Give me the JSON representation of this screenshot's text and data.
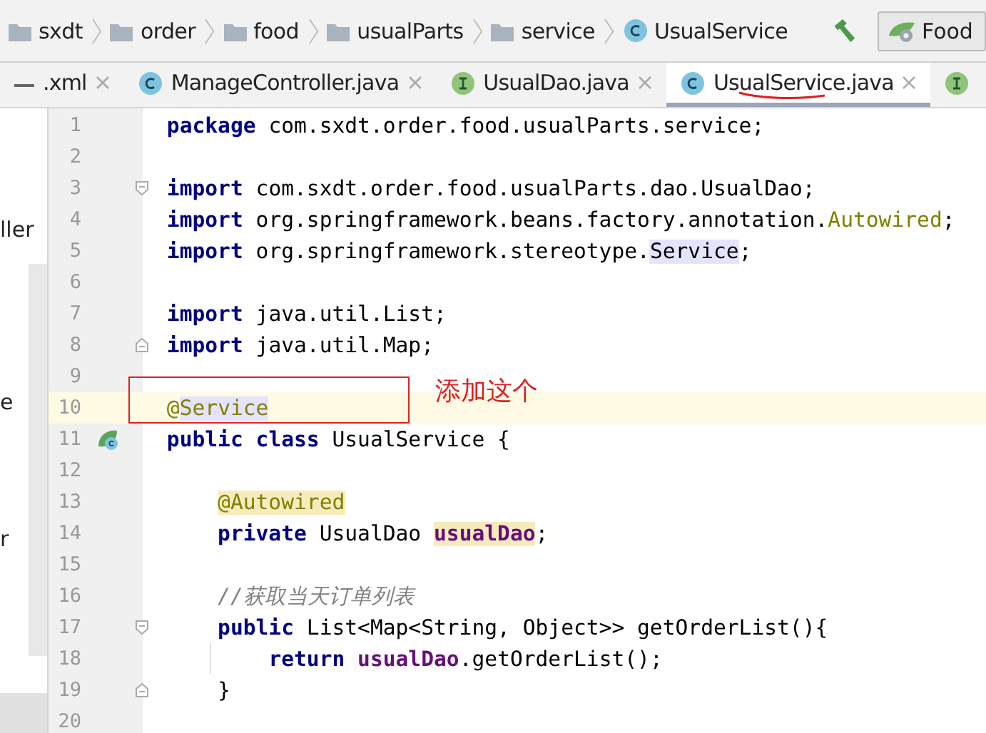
{
  "breadcrumbs": [
    {
      "label": "sxdt",
      "kind": "folder"
    },
    {
      "label": "order",
      "kind": "folder"
    },
    {
      "label": "food",
      "kind": "folder"
    },
    {
      "label": "usualParts",
      "kind": "folder"
    },
    {
      "label": "service",
      "kind": "folder"
    },
    {
      "label": "UsualService",
      "kind": "class"
    }
  ],
  "run_config": {
    "label": "Food"
  },
  "tabs": [
    {
      "label": ".xml",
      "closable": true,
      "selected": false
    },
    {
      "label": "ManageController.java",
      "kind": "class",
      "closable": true,
      "selected": false
    },
    {
      "label": "UsualDao.java",
      "kind": "interface",
      "closable": true,
      "selected": false
    },
    {
      "label": "UsualService.java",
      "kind": "class",
      "closable": true,
      "selected": true
    },
    {
      "kind": "interface",
      "closable": false,
      "selected": false
    }
  ],
  "side_panel": {
    "fragments": [
      "ller",
      "e",
      "r"
    ]
  },
  "editor": {
    "lines": [
      {
        "number": "1",
        "kind": "plain",
        "current": false,
        "tokens": [
          {
            "text": "package",
            "kind": "keyword"
          },
          {
            "text": " com.sxdt.order.food.usualParts.service;",
            "kind": "plain"
          }
        ]
      },
      {
        "number": "2",
        "kind": "plain",
        "current": false
      },
      {
        "number": "3",
        "kind": "fold-start",
        "current": false,
        "tokens": [
          {
            "text": "import",
            "kind": "keyword"
          },
          {
            "text": " com.sxdt.order.food.usualParts.dao.UsualDao;",
            "kind": "plain"
          }
        ]
      },
      {
        "number": "4",
        "kind": "plain",
        "current": false,
        "tokens": [
          {
            "text": "import",
            "kind": "keyword"
          },
          {
            "text": " org.springframework.beans.factory.annotation.",
            "kind": "plain"
          },
          {
            "text": "Autowired",
            "kind": "annotation"
          },
          {
            "text": ";",
            "kind": "plain"
          }
        ]
      },
      {
        "number": "5",
        "kind": "plain",
        "current": false,
        "tokens": [
          {
            "text": "import",
            "kind": "keyword"
          },
          {
            "text": " org.springframework.stereotype.",
            "kind": "plain"
          },
          {
            "text": "Service",
            "kind": "usage"
          },
          {
            "text": ";",
            "kind": "plain"
          }
        ]
      },
      {
        "number": "6",
        "kind": "plain",
        "current": false
      },
      {
        "number": "7",
        "kind": "plain",
        "current": false,
        "tokens": [
          {
            "text": "import",
            "kind": "keyword"
          },
          {
            "text": " java.util.List;",
            "kind": "plain"
          }
        ]
      },
      {
        "number": "8",
        "kind": "fold-end",
        "current": false,
        "tokens": [
          {
            "text": "import",
            "kind": "keyword"
          },
          {
            "text": " java.util.Map;",
            "kind": "plain"
          }
        ]
      },
      {
        "number": "9",
        "kind": "plain",
        "current": false
      },
      {
        "number": "10",
        "kind": "plain",
        "current": true,
        "tokens": [
          {
            "text": "@",
            "kind": "annotation"
          },
          {
            "text": "Service",
            "kind": "annotation-usage"
          }
        ]
      },
      {
        "number": "11",
        "kind": "bean",
        "current": false,
        "tokens": [
          {
            "text": "public class",
            "kind": "keyword"
          },
          {
            "text": " UsualService {",
            "kind": "plain"
          }
        ],
        "children": [
          {
            "number": "12",
            "kind": "plain",
            "current": false
          },
          {
            "number": "13",
            "kind": "plain",
            "current": false,
            "tokens": [
              {
                "text": "@Autowired",
                "kind": "annotation-warning"
              }
            ]
          },
          {
            "number": "14",
            "kind": "plain",
            "current": false,
            "tokens": [
              {
                "text": "private",
                "kind": "keyword"
              },
              {
                "text": " UsualDao ",
                "kind": "plain"
              },
              {
                "text": "usualDao",
                "kind": "field-warning"
              },
              {
                "text": ";",
                "kind": "plain"
              }
            ]
          },
          {
            "number": "15",
            "kind": "plain",
            "current": false
          },
          {
            "number": "16",
            "kind": "plain",
            "current": false,
            "tokens": [
              {
                "text": "//获取当天订单列表",
                "kind": "comment"
              }
            ]
          },
          {
            "number": "17",
            "kind": "fold-start",
            "current": false,
            "tokens": [
              {
                "text": "public",
                "kind": "keyword"
              },
              {
                "text": " List<Map<String, Object>> getOrderList(){",
                "kind": "plain"
              }
            ],
            "children": [
              {
                "number": "18",
                "kind": "indent-guide",
                "current": false,
                "tokens": [
                  {
                    "text": "return",
                    "kind": "keyword"
                  },
                  {
                    "text": " usualDao",
                    "kind": "field"
                  },
                  {
                    "text": ".getOrderList();",
                    "kind": "plain"
                  }
                ]
              }
            ]
          },
          {
            "number": "19",
            "kind": "fold-end",
            "current": false,
            "tokens": [
              {
                "text": "}",
                "kind": "plain"
              }
            ]
          }
        ]
      },
      {
        "number": "20",
        "kind": "plain",
        "current": false
      }
    ]
  },
  "callout": {
    "text": "添加这个"
  }
}
